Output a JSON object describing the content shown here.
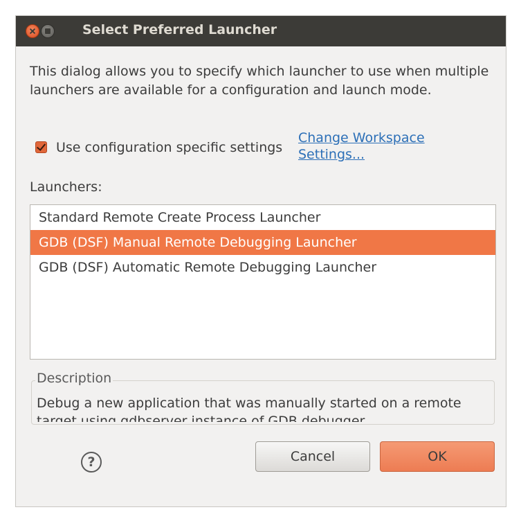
{
  "window": {
    "title": "Select Preferred Launcher"
  },
  "intro": {
    "text": "This dialog allows you to specify which launcher to use when multiple launchers are available for a configuration and launch mode."
  },
  "config_specific": {
    "checked": true,
    "label": "Use configuration specific settings"
  },
  "workspace_link": {
    "label": "Change Workspace Settings..."
  },
  "launchers": {
    "label": "Launchers:",
    "items": [
      {
        "label": "Standard Remote Create Process Launcher",
        "selected": false
      },
      {
        "label": "GDB (DSF) Manual Remote Debugging Launcher",
        "selected": true
      },
      {
        "label": "GDB (DSF) Automatic Remote Debugging Launcher",
        "selected": false
      }
    ]
  },
  "description": {
    "legend": "Description",
    "text": "Debug a new application that was manually started on a remote target using gdbserver instance of GDB debugger"
  },
  "buttons": {
    "help": "?",
    "cancel": "Cancel",
    "ok": "OK"
  },
  "colors": {
    "accent": "#f07746",
    "titlebar": "#3c3b37",
    "link": "#2c6fb7",
    "background": "#f2f1f0"
  }
}
